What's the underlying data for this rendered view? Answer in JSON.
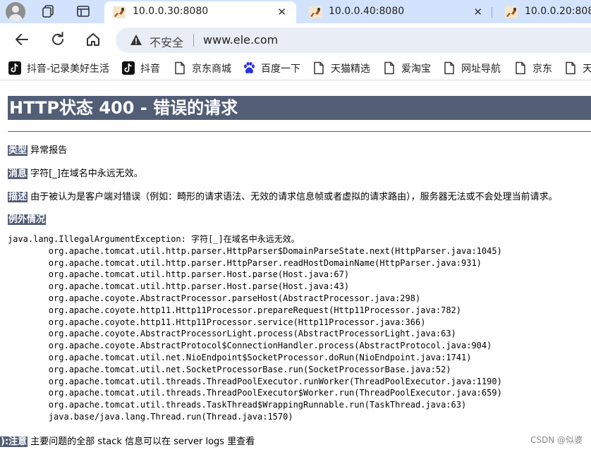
{
  "tabs": [
    {
      "title": "10.0.0.30:8080",
      "close": "✕"
    },
    {
      "title": "10.0.0.40:8080",
      "close": "✕"
    },
    {
      "title": "10.0.0.20:8080",
      "close": ""
    }
  ],
  "address": {
    "security_label": "不安全",
    "url": "www.ele.com"
  },
  "bookmarks": [
    {
      "label": "抖音-记录美好生活",
      "icon": "tiktok-icon"
    },
    {
      "label": "抖音",
      "icon": "tiktok-icon"
    },
    {
      "label": "京东商城",
      "icon": "page-icon"
    },
    {
      "label": "百度一下",
      "icon": "baidu-paw-icon"
    },
    {
      "label": "天猫精选",
      "icon": "page-icon"
    },
    {
      "label": "爱淘宝",
      "icon": "page-icon"
    },
    {
      "label": "网址导航",
      "icon": "page-icon"
    },
    {
      "label": "京东",
      "icon": "page-icon"
    },
    {
      "label": "天",
      "icon": "page-icon"
    }
  ],
  "error": {
    "heading": "HTTP状态 400 - 错误的请求",
    "type_label": "类型",
    "type_value": "异常报告",
    "message_label": "消息",
    "message_value": "字符[_]在域名中永远无效。",
    "desc_label": "描述",
    "desc_value": "由于被认为是客户端对错误（例如：畸形的请求语法、无效的请求信息帧或者虚拟的请求路由），服务器无法或不会处理当前请求。",
    "exception_label": "例外情况",
    "note_label": "注意",
    "note_prefix": "):",
    "note_value": "主要问题的全部 stack 信息可以在 server logs 里查看"
  },
  "stack_trace": [
    "java.lang.IllegalArgumentException: 字符[_]在域名中永远无效。",
    "\torg.apache.tomcat.util.http.parser.HttpParser$DomainParseState.next(HttpParser.java:1045)",
    "\torg.apache.tomcat.util.http.parser.HttpParser.readHostDomainName(HttpParser.java:931)",
    "\torg.apache.tomcat.util.http.parser.Host.parse(Host.java:67)",
    "\torg.apache.tomcat.util.http.parser.Host.parse(Host.java:43)",
    "\torg.apache.coyote.AbstractProcessor.parseHost(AbstractProcessor.java:298)",
    "\torg.apache.coyote.http11.Http11Processor.prepareRequest(Http11Processor.java:782)",
    "\torg.apache.coyote.http11.Http11Processor.service(Http11Processor.java:366)",
    "\torg.apache.coyote.AbstractProcessorLight.process(AbstractProcessorLight.java:63)",
    "\torg.apache.coyote.AbstractProtocol$ConnectionHandler.process(AbstractProtocol.java:904)",
    "\torg.apache.tomcat.util.net.NioEndpoint$SocketProcessor.doRun(NioEndpoint.java:1741)",
    "\torg.apache.tomcat.util.net.SocketProcessorBase.run(SocketProcessorBase.java:52)",
    "\torg.apache.tomcat.util.threads.ThreadPoolExecutor.runWorker(ThreadPoolExecutor.java:1190)",
    "\torg.apache.tomcat.util.threads.ThreadPoolExecutor$Worker.run(ThreadPoolExecutor.java:659)",
    "\torg.apache.tomcat.util.threads.TaskThread$WrappingRunnable.run(TaskThread.java:63)",
    "\tjava.base/java.lang.Thread.run(Thread.java:1570)"
  ],
  "watermark": "CSDN @似婆",
  "colors": {
    "tab_strip": "#d3e3fd",
    "tomcat_header": "#525d76",
    "omnibox": "#e9eef6"
  }
}
